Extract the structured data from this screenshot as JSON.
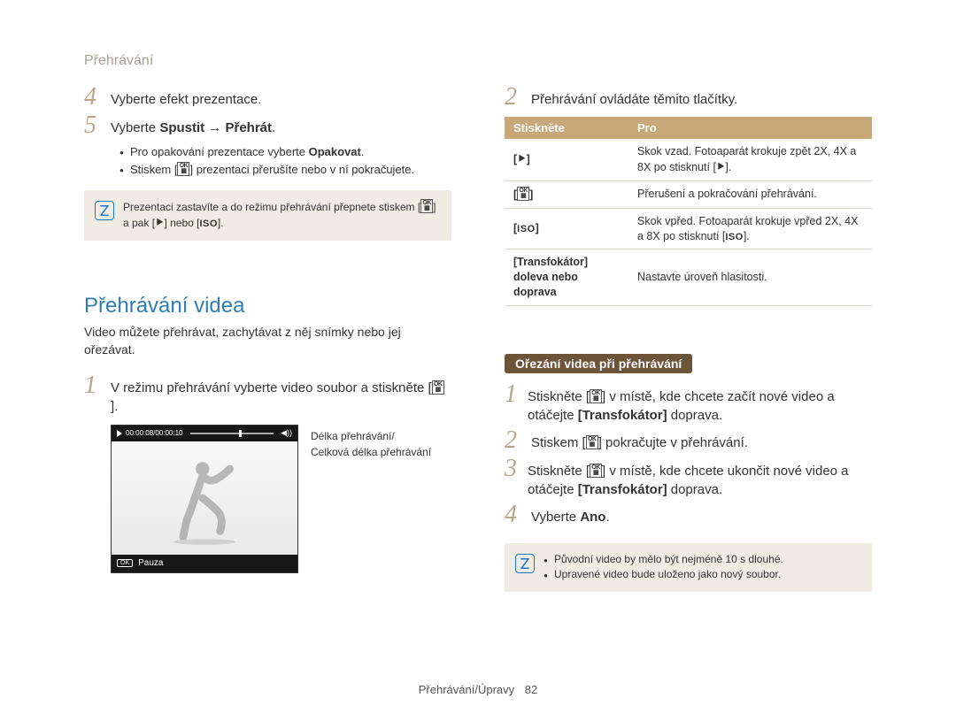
{
  "header": "Přehrávání",
  "left": {
    "step4": "Vyberte efekt prezentace.",
    "step5_a": "Vyberte ",
    "step5_b": "Spustit → Přehrát",
    "step5_c": ".",
    "bullets": [
      "Pro opakování prezentace vyberte ",
      "Opakovat",
      "Stiskem [",
      "] prezentaci přerušíte nebo v ní pokračujete."
    ],
    "note_a": "Prezentaci zastavíte a do režimu přehrávání přepnete stiskem [",
    "note_b": "] a pak [",
    "note_c": "] nebo [",
    "note_d": "].",
    "section_heading": "Přehrávání videa",
    "section_sub": "Video můžete přehrávat, zachytávat z něj snímky nebo jej ořezávat.",
    "step1_a": "V režimu přehrávání vyberte video soubor a stiskněte [",
    "step1_b": "].",
    "timecode": "00:00:08/00:00:10",
    "pause": "Pauza",
    "ok": "OK",
    "annot1": "Délka přehrávání/",
    "annot2": "Celková délka přehrávání"
  },
  "right": {
    "step2": "Přehrávání ovládáte těmito tlačítky.",
    "th1": "Stiskněte",
    "th2": "Pro",
    "row1_btn": "[ ⯈ ]",
    "row1_txt_a": "Skok vzad. Fotoaparát krokuje zpět 2X, 4X a 8X po stisknutí [",
    "row1_txt_b": "].",
    "row2_btn": "[ OK ]",
    "row2_txt": "Přerušení a pokračování přehrávání.",
    "row3_btn": "[ISO]",
    "row3_txt_a": "Skok vpřed. Fotoaparát krokuje vpřed 2X, 4X a 8X po stisknutí [",
    "row3_txt_b": "].",
    "row4_btn": "[Transfokátor] doleva nebo doprava",
    "row4_txt": "Nastavte úroveň hlasitosti.",
    "pill": "Ořezání videa při přehrávání",
    "t_step1_a": "Stiskněte [",
    "t_step1_b": "] v místě, kde chcete začít nové video a otáčejte ",
    "t_step1_c": "[Transfokátor]",
    "t_step1_d": " doprava.",
    "t_step2_a": "Stiskem [",
    "t_step2_b": "] pokračujte v přehrávání.",
    "t_step3_a": "Stiskněte [",
    "t_step3_b": "] v místě, kde chcete ukončit nové video a otáčejte ",
    "t_step3_c": "[Transfokátor]",
    "t_step3_d": " doprava.",
    "t_step4_a": "Vyberte ",
    "t_step4_b": "Ano",
    "t_step4_c": ".",
    "note_li1": "Původní video by mělo být nejméně 10 s dlouhé.",
    "note_li2": "Upravené video bude uloženo jako nový soubor."
  },
  "glyphs": {
    "ok_stack": "OK\n▦",
    "flash": "⯈",
    "iso": "ISO"
  },
  "footer": {
    "label": "Přehrávání/Úpravy",
    "page": "82"
  }
}
